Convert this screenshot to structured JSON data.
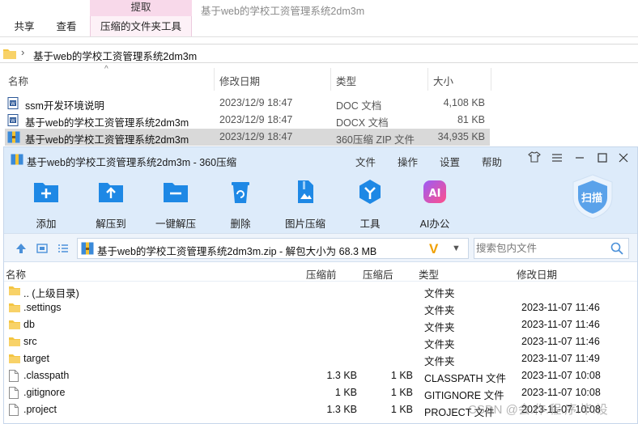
{
  "explorer": {
    "context_tab_header": "提取",
    "window_title": "基于web的学校工资管理系统2dm3m",
    "ribbon_tabs": [
      "共享",
      "查看",
      "压缩的文件夹工具"
    ],
    "address_path": "基于web的学校工资管理系统2dm3m",
    "columns": [
      "名称",
      "修改日期",
      "类型",
      "大小"
    ],
    "files": [
      {
        "name": "ssm开发环境说明",
        "date": "2023/12/9 18:47",
        "type": "DOC 文档",
        "size": "4,108 KB",
        "icon": "word-doc-icon"
      },
      {
        "name": "基于web的学校工资管理系统2dm3m",
        "date": "2023/12/9 18:47",
        "type": "DOCX 文档",
        "size": "81 KB",
        "icon": "word-docx-icon"
      },
      {
        "name": "基于web的学校工资管理系统2dm3m",
        "date": "2023/12/9 18:47",
        "type": "360压缩 ZIP 文件",
        "size": "34,935 KB",
        "icon": "zip-archive-icon"
      }
    ]
  },
  "zip_window": {
    "title": "基于web的学校工资管理系统2dm3m - 360压缩",
    "menu": [
      "文件",
      "操作",
      "设置",
      "帮助"
    ],
    "toolbar": [
      {
        "label": "添加",
        "icon": "add-folder-icon"
      },
      {
        "label": "解压到",
        "icon": "extract-to-icon"
      },
      {
        "label": "一键解压",
        "icon": "one-click-extract-icon"
      },
      {
        "label": "删除",
        "icon": "delete-icon"
      },
      {
        "label": "图片压缩",
        "icon": "image-compress-icon"
      },
      {
        "label": "工具",
        "icon": "tools-icon"
      },
      {
        "label": "AI办公",
        "icon": "ai-office-icon"
      }
    ],
    "scan_label": "扫描",
    "path_text": "基于web的学校工资管理系统2dm3m.zip - 解包大小为 68.3 MB",
    "search_placeholder": "搜索包内文件",
    "columns": [
      "名称",
      "压缩前",
      "压缩后",
      "类型",
      "修改日期"
    ],
    "entries": [
      {
        "name": ".. (上级目录)",
        "before": "",
        "after": "",
        "type": "文件夹",
        "date": "",
        "kind": "folder"
      },
      {
        "name": ".settings",
        "before": "",
        "after": "",
        "type": "文件夹",
        "date": "2023-11-07 11:46",
        "kind": "folder"
      },
      {
        "name": "db",
        "before": "",
        "after": "",
        "type": "文件夹",
        "date": "2023-11-07 11:46",
        "kind": "folder"
      },
      {
        "name": "src",
        "before": "",
        "after": "",
        "type": "文件夹",
        "date": "2023-11-07 11:46",
        "kind": "folder"
      },
      {
        "name": "target",
        "before": "",
        "after": "",
        "type": "文件夹",
        "date": "2023-11-07 11:49",
        "kind": "folder"
      },
      {
        "name": ".classpath",
        "before": "1.3 KB",
        "after": "1 KB",
        "type": "CLASSPATH 文件",
        "date": "2023-11-07 10:08",
        "kind": "file"
      },
      {
        "name": ".gitignore",
        "before": "1 KB",
        "after": "1 KB",
        "type": "GITIGNORE 文件",
        "date": "2023-11-07 10:08",
        "kind": "file"
      },
      {
        "name": ".project",
        "before": "1.3 KB",
        "after": "1 KB",
        "type": "PROJECT 文件",
        "date": "2023-11-07 10:08",
        "kind": "file"
      }
    ]
  },
  "watermark": "CSDN @会.作.程.序.毕.设",
  "colors": {
    "zip_header_bg": "#ddebfa",
    "context_tab": "#f8d9ea",
    "accent_blue": "#1e88e5",
    "selected_row": "#d9d9d9",
    "folder": "#f4c542"
  }
}
